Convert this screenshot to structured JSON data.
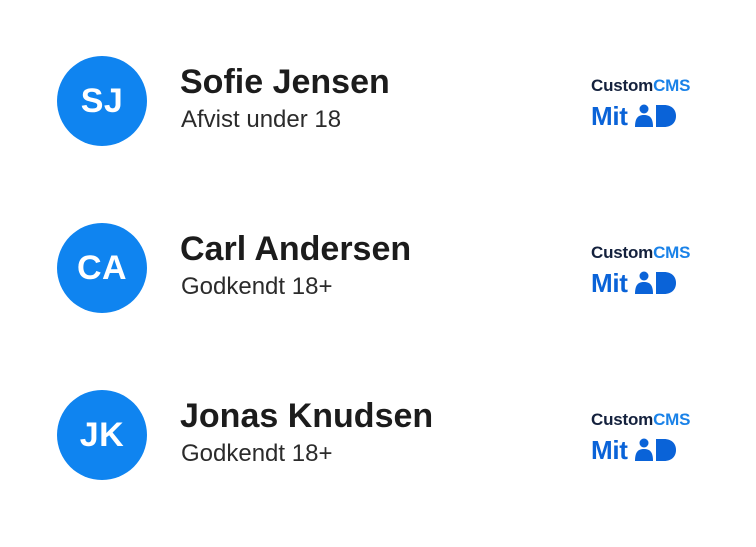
{
  "users": [
    {
      "initials": "SJ",
      "name": "Sofie Jensen",
      "status": "Afvist under 18"
    },
    {
      "initials": "CA",
      "name": "Carl Andersen",
      "status": "Godkendt 18+"
    },
    {
      "initials": "JK",
      "name": "Jonas Knudsen",
      "status": "Godkendt 18+"
    }
  ],
  "badge": {
    "brand_part_1": "Custom",
    "brand_part_2": "CMS",
    "provider": "Mit",
    "provider_icon": "mitid-logo-icon"
  },
  "colors": {
    "avatar": "#0f84f0",
    "brand_dark": "#14213d",
    "brand_accent": "#1a82e8",
    "mitid_blue": "#0a63d8"
  }
}
